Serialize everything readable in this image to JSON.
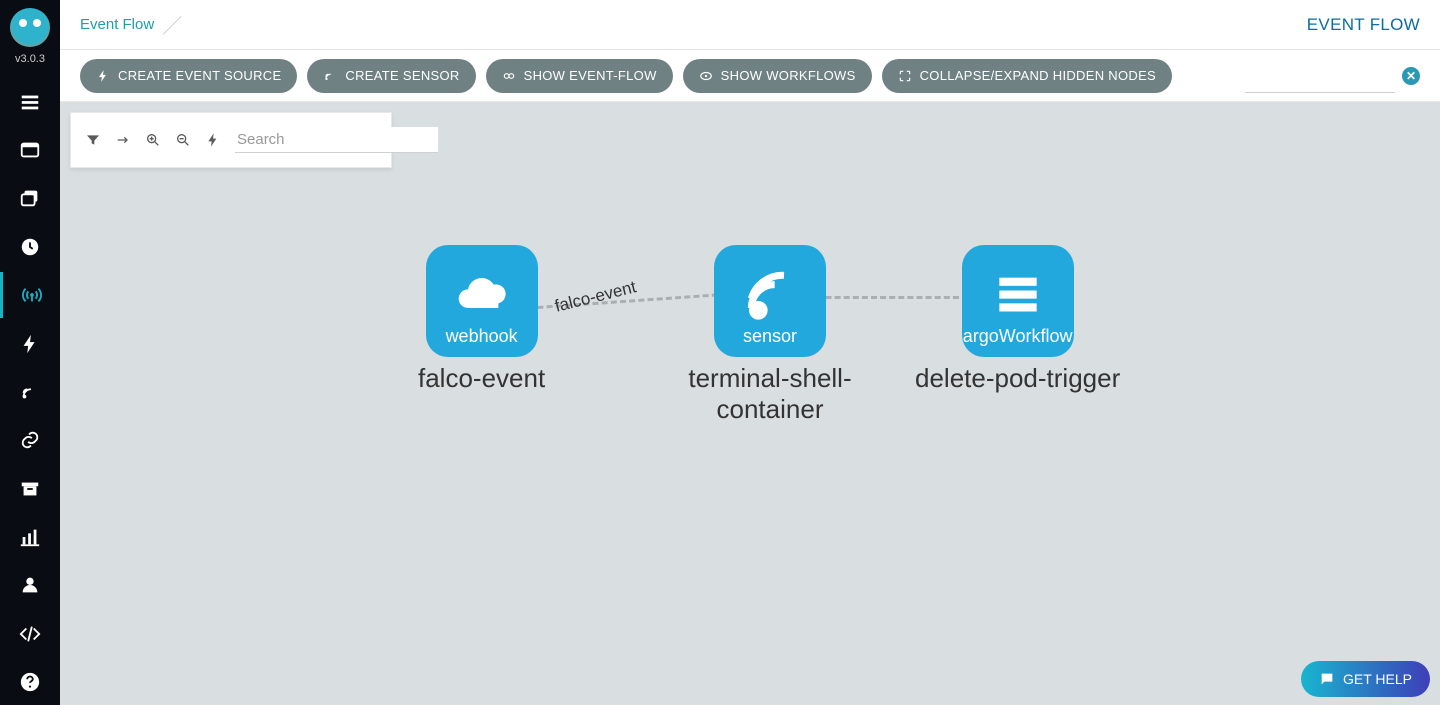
{
  "app": {
    "version": "v3.0.3"
  },
  "header": {
    "breadcrumb_root": "Event Flow",
    "page_title": "EVENT FLOW"
  },
  "toolbar": {
    "create_event_source": "CREATE EVENT SOURCE",
    "create_sensor": "CREATE SENSOR",
    "show_event_flow": "SHOW EVENT-FLOW",
    "show_workflows": "SHOW WORKFLOWS",
    "collapse_expand": "COLLAPSE/EXPAND HIDDEN NODES"
  },
  "filter_panel": {
    "search_placeholder": "Search"
  },
  "sidebar": {
    "items": [
      {
        "name": "workflows"
      },
      {
        "name": "submit"
      },
      {
        "name": "templates"
      },
      {
        "name": "cron"
      },
      {
        "name": "event-flow",
        "active": true
      },
      {
        "name": "event-sources"
      },
      {
        "name": "sensors"
      },
      {
        "name": "artifacts"
      },
      {
        "name": "archive"
      },
      {
        "name": "reports"
      },
      {
        "name": "user"
      },
      {
        "name": "api-docs"
      },
      {
        "name": "help"
      }
    ]
  },
  "graph": {
    "edge_label": "falco-event",
    "nodes": [
      {
        "type_label": "webhook",
        "title": "falco-event",
        "icon": "cloud"
      },
      {
        "type_label": "sensor",
        "title": "terminal-shell-container",
        "icon": "satellite"
      },
      {
        "type_label": "argoWorkflow",
        "title": "delete-pod-trigger",
        "icon": "bars"
      }
    ]
  },
  "help_button": "GET HELP"
}
